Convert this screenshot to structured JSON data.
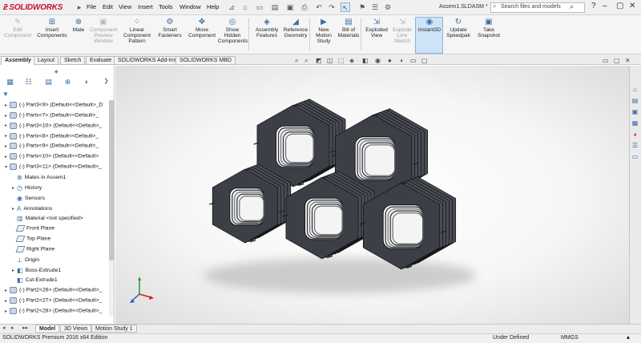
{
  "app": {
    "logo_text": "SOLIDWORKS",
    "document_title": "Assem1.SLDASM *",
    "menu": [
      "File",
      "Edit",
      "View",
      "Insert",
      "Tools",
      "Window",
      "Help"
    ]
  },
  "search": {
    "placeholder": "Search files and models"
  },
  "commands": [
    {
      "label1": "Edit",
      "label2": "Component",
      "label3": "",
      "icon": "edit-component-icon",
      "disabled": true
    },
    {
      "label1": "Insert",
      "label2": "Components",
      "label3": "",
      "icon": "insert-components-icon",
      "disabled": false
    },
    {
      "label1": "Mate",
      "label2": "",
      "label3": "",
      "icon": "mate-icon",
      "disabled": false
    },
    {
      "label1": "Component",
      "label2": "Preview",
      "label3": "Window",
      "icon": "component-preview-icon",
      "disabled": true
    },
    {
      "label1": "Linear",
      "label2": "Component",
      "label3": "Pattern",
      "icon": "linear-pattern-icon",
      "disabled": false
    },
    {
      "label1": "Smart",
      "label2": "Fasteners",
      "label3": "",
      "icon": "smart-fasteners-icon",
      "disabled": false
    },
    {
      "label1": "Move",
      "label2": "Component",
      "label3": "",
      "icon": "move-component-icon",
      "disabled": false
    },
    {
      "label1": "Show",
      "label2": "Hidden",
      "label3": "Components",
      "icon": "show-hidden-icon",
      "disabled": false
    },
    {
      "label1": "Assembly",
      "label2": "Features",
      "label3": "",
      "icon": "assembly-features-icon",
      "disabled": false
    },
    {
      "label1": "Reference",
      "label2": "Geometry",
      "label3": "",
      "icon": "reference-geometry-icon",
      "disabled": false
    },
    {
      "label1": "New",
      "label2": "Motion",
      "label3": "Study",
      "icon": "motion-study-icon",
      "disabled": false
    },
    {
      "label1": "Bill of",
      "label2": "Materials",
      "label3": "",
      "icon": "bom-icon",
      "disabled": false
    },
    {
      "label1": "Exploded",
      "label2": "View",
      "label3": "",
      "icon": "exploded-view-icon",
      "disabled": false
    },
    {
      "label1": "Explode",
      "label2": "Line",
      "label3": "Sketch",
      "icon": "explode-line-icon",
      "disabled": true
    },
    {
      "label1": "Instant3D",
      "label2": "",
      "label3": "",
      "icon": "instant3d-icon",
      "disabled": false
    },
    {
      "label1": "Update",
      "label2": "Speedpak",
      "label3": "",
      "icon": "speedpak-icon",
      "disabled": false
    },
    {
      "label1": "Take",
      "label2": "Snapshot",
      "label3": "",
      "icon": "snapshot-icon",
      "disabled": false
    }
  ],
  "command_tabs": [
    "Assembly",
    "Layout",
    "Sketch",
    "Evaluate",
    "SOLIDWORKS Add-Ins",
    "SOLIDWORKS MBD"
  ],
  "active_command_tab": "Assembly",
  "tree": [
    {
      "label": "(-) Part3<9> (Default<<Default>_D",
      "type": "part",
      "expand": "▸"
    },
    {
      "label": "(-) Partx<7> (Default<<Default>_",
      "type": "part",
      "expand": "▸"
    },
    {
      "label": "(-) Part3<10> (Default<<Default>_",
      "type": "part",
      "expand": "▸"
    },
    {
      "label": "(-) Partx<8> (Default<<Default>_",
      "type": "part",
      "expand": "▸"
    },
    {
      "label": "(-) Partx<9> (Default<<Default>_",
      "type": "part",
      "expand": "▸"
    },
    {
      "label": "(-) Partx<10> (Default<<Default>",
      "type": "part",
      "expand": "▸"
    },
    {
      "label": "(-) Part3<11> (Default<<Default>_",
      "type": "part",
      "expand": "▾"
    },
    {
      "label": "Mates in Assem1",
      "type": "mates",
      "expand": ""
    },
    {
      "label": "History",
      "type": "history",
      "expand": "▸"
    },
    {
      "label": "Sensors",
      "type": "sensor",
      "expand": ""
    },
    {
      "label": "Annotations",
      "type": "annot",
      "expand": "▸"
    },
    {
      "label": "Material <not specified>",
      "type": "material",
      "expand": ""
    },
    {
      "label": "Front Plane",
      "type": "plane",
      "expand": ""
    },
    {
      "label": "Top Plane",
      "type": "plane",
      "expand": ""
    },
    {
      "label": "Right Plane",
      "type": "plane",
      "expand": ""
    },
    {
      "label": "Origin",
      "type": "origin",
      "expand": ""
    },
    {
      "label": "Boss-Extrude1",
      "type": "feature",
      "expand": "▸"
    },
    {
      "label": "Cut-Extrude1",
      "type": "feature",
      "expand": ""
    },
    {
      "label": "(-) Part2<26> (Default<<Default>_",
      "type": "part",
      "expand": "▸"
    },
    {
      "label": "(-) Part2<27> (Default<<Default>_",
      "type": "part",
      "expand": "▸"
    },
    {
      "label": "(-) Part2<28> (Default<<Default>_",
      "type": "part",
      "expand": "▸"
    }
  ],
  "bottom_tabs": [
    "Model",
    "3D Views",
    "Motion Study 1"
  ],
  "active_bottom_tab": "Model",
  "status": {
    "edition": "SOLIDWORKS Premium 2016 x64 Edition",
    "state": "Under Defined",
    "units": "MMGS"
  },
  "colors": {
    "model": "#3d3f47",
    "model_edge": "#15161a",
    "accent": "#c8102e"
  }
}
